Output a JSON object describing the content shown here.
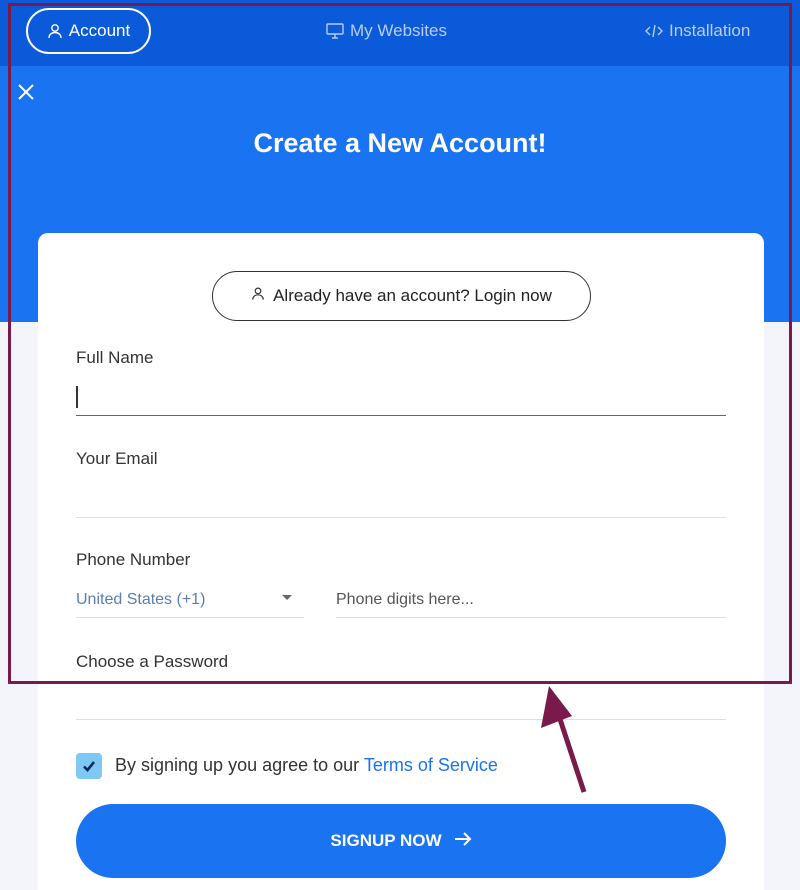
{
  "nav": {
    "account_label": "Account",
    "websites_label": "My Websites",
    "installation_label": "Installation"
  },
  "hero": {
    "title": "Create a New Account!"
  },
  "login": {
    "label": "Already have an account? Login now"
  },
  "form": {
    "full_name_label": "Full Name",
    "full_name_value": "",
    "email_label": "Your Email",
    "email_value": "",
    "phone_label": "Phone Number",
    "country_value": "United States (+1)",
    "phone_placeholder": "Phone digits here...",
    "password_label": "Choose a Password",
    "terms_text": "By signing up you agree to our ",
    "terms_link": "Terms of Service",
    "terms_checked": true,
    "submit_label": "SIGNUP NOW"
  },
  "colors": {
    "nav_bg": "#0b5ad9",
    "hero_bg": "#1a73f0",
    "accent": "#1a73f0",
    "checkbox": "#7dc8f4",
    "annotation": "#7a1a4a"
  },
  "icons": [
    "user-icon",
    "monitor-icon",
    "code-icon",
    "close-icon",
    "chevron-down-icon",
    "check-icon",
    "arrow-right-icon"
  ]
}
